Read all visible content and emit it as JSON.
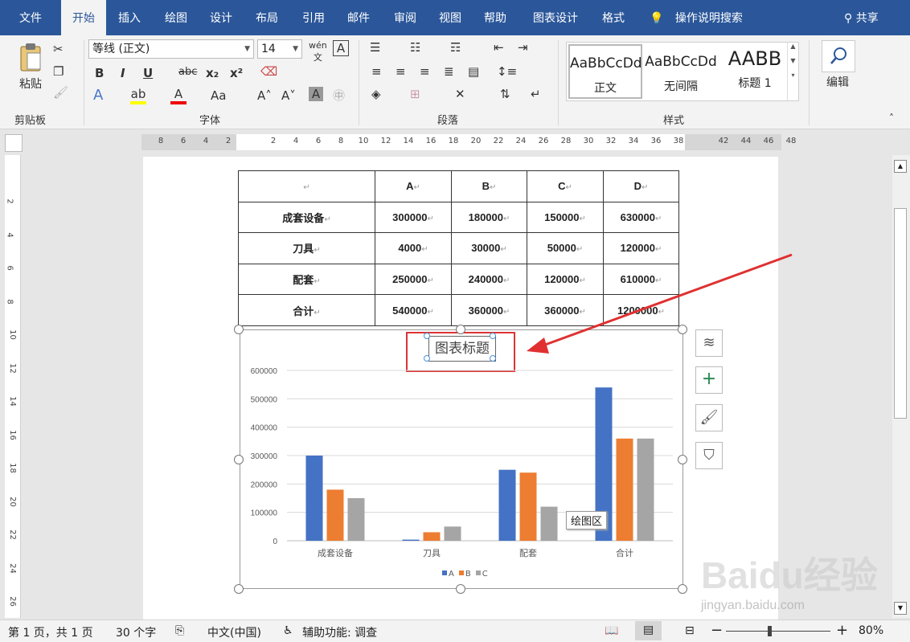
{
  "tabs": [
    "文件",
    "开始",
    "插入",
    "绘图",
    "设计",
    "布局",
    "引用",
    "邮件",
    "审阅",
    "视图",
    "帮助",
    "图表设计",
    "格式"
  ],
  "tell_me": "操作说明搜索",
  "share": "共享",
  "ribbon": {
    "paste": "粘贴",
    "clipboard": "剪贴板",
    "font_name": "等线 (正文)",
    "font_size": "14",
    "font_group": "字体",
    "paragraph_group": "段落",
    "styles_group": "样式",
    "edit": "编辑",
    "bold": "B",
    "italic": "I",
    "underline": "U",
    "strike": "abc",
    "sub": "x₂",
    "sup": "x²",
    "case": "Aa",
    "styles": [
      {
        "sample": "AaBbCcDd",
        "name": "正文"
      },
      {
        "sample": "AaBbCcDd",
        "name": "无间隔"
      },
      {
        "sample": "AABB",
        "name": "标题 1"
      }
    ]
  },
  "ruler_h": [
    "8",
    "6",
    "4",
    "2",
    "",
    "2",
    "4",
    "6",
    "8",
    "10",
    "12",
    "14",
    "16",
    "18",
    "20",
    "22",
    "24",
    "26",
    "28",
    "30",
    "32",
    "34",
    "36",
    "38",
    "",
    "42",
    "44",
    "46",
    "48"
  ],
  "ruler_v": [
    "2",
    "4",
    "6",
    "8",
    "10",
    "12",
    "14",
    "16",
    "18",
    "20",
    "22",
    "24",
    "26"
  ],
  "table": {
    "header": [
      "",
      "A",
      "B",
      "C",
      "D"
    ],
    "rows": [
      [
        "成套设备",
        "300000",
        "180000",
        "150000",
        "630000"
      ],
      [
        "刀具",
        "4000",
        "30000",
        "50000",
        "120000"
      ],
      [
        "配套",
        "250000",
        "240000",
        "120000",
        "610000"
      ],
      [
        "合计",
        "540000",
        "360000",
        "360000",
        "1200000"
      ]
    ]
  },
  "chart_data": {
    "type": "bar",
    "title": "图表标题",
    "categories": [
      "成套设备",
      "刀具",
      "配套",
      "合计"
    ],
    "series": [
      {
        "name": "A",
        "color": "#4472c4",
        "values": [
          300000,
          4000,
          250000,
          540000
        ]
      },
      {
        "name": "B",
        "color": "#ed7d31",
        "values": [
          180000,
          30000,
          240000,
          360000
        ]
      },
      {
        "name": "C",
        "color": "#a5a5a5",
        "values": [
          150000,
          50000,
          120000,
          360000
        ]
      }
    ],
    "yticks": [
      "0",
      "100000",
      "200000",
      "300000",
      "400000",
      "500000",
      "600000"
    ],
    "ylim": [
      0,
      600000
    ],
    "grid": true,
    "legend": "bottom"
  },
  "tooltip": "绘图区",
  "status": {
    "page": "第 1 页，共 1 页",
    "words": "30 个字",
    "lang": "中文(中国)",
    "access": "辅助功能: 调查",
    "zoom": "80%"
  },
  "watermark": "Baidu经验",
  "watermark_url": "jingyan.baidu.com"
}
